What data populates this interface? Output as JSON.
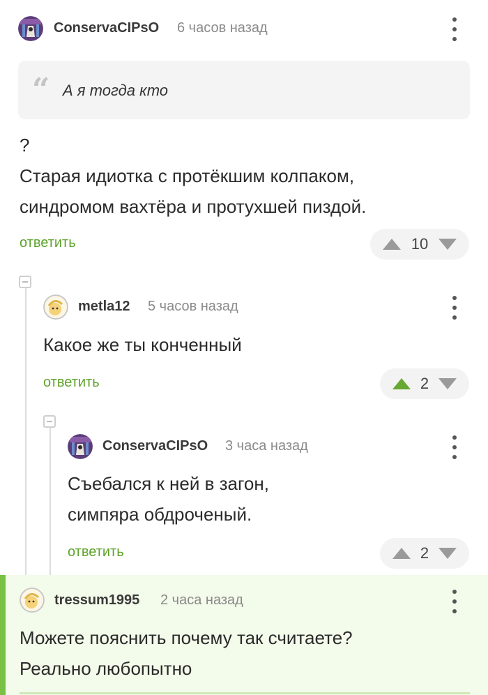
{
  "comments": [
    {
      "username": "ConservaCIPsO",
      "time": "6 часов назад",
      "quote": "А я тогда кто",
      "lines": [
        "?",
        "Старая идиотка с протёкшим колпаком,",
        "синдромом вахтёра и протухшей пиздой."
      ],
      "reply_label": "ответить",
      "votes": "10",
      "upvoted": false
    },
    {
      "username": "metla12",
      "time": "5 часов назад",
      "lines": [
        "Какое же ты конченный"
      ],
      "reply_label": "ответить",
      "votes": "2",
      "upvoted": true
    },
    {
      "username": "ConservaCIPsO",
      "time": "3 часа назад",
      "lines": [
        "Съебался к ней в загон,",
        "симпяра обдроченый."
      ],
      "reply_label": "ответить",
      "votes": "2",
      "upvoted": false
    },
    {
      "username": "tressum1995",
      "time": "2 часа назад",
      "lines": [
        "Можете пояснить почему так считаете?",
        "Реально любопытно"
      ],
      "highlighted": true
    }
  ],
  "colors": {
    "accent_green": "#5da22a",
    "upvote_active": "#67a832",
    "highlight_bg": "#f3fbea",
    "highlight_bar": "#79c143"
  },
  "icons": [
    "avatar-conserva",
    "avatar-metla12",
    "avatar-tressum",
    "quote-icon",
    "more-vertical-icon",
    "upvote-arrow-icon",
    "downvote-arrow-icon",
    "collapse-thread-icon"
  ]
}
